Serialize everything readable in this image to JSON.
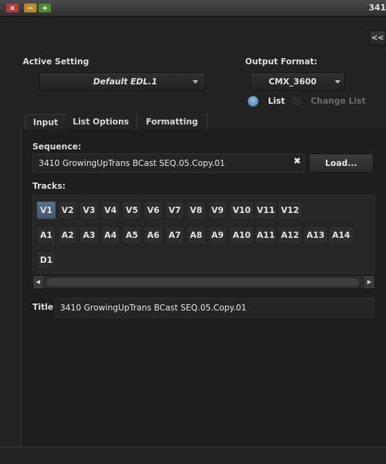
{
  "window": {
    "title_number": "341",
    "collapse_label": "<<"
  },
  "settings": {
    "active_setting_label": "Active Setting",
    "active_setting_value": "Default EDL.1",
    "output_format_label": "Output Format:",
    "output_format_value": "CMX_3600",
    "radio_list": "List",
    "radio_change_list": "Change List",
    "list_selected": true
  },
  "tabs": [
    {
      "label": "Input",
      "active": true
    },
    {
      "label": "List Options",
      "active": false
    },
    {
      "label": "Formatting",
      "active": false
    }
  ],
  "input": {
    "sequence_label": "Sequence:",
    "sequence_value": "3410 GrowingUpTrans BCast SEQ.05.Copy.01",
    "clear_glyph": "✖",
    "load_label": "Load...",
    "tracks_label": "Tracks:",
    "title_label": "Title",
    "title_value": "3410 GrowingUpTrans BCast SEQ.05.Copy.01"
  },
  "tracks": {
    "video": [
      "V1",
      "V2",
      "V3",
      "V4",
      "V5",
      "V6",
      "V7",
      "V8",
      "V9",
      "V10",
      "V11",
      "V12"
    ],
    "audio": [
      "A1",
      "A2",
      "A3",
      "A4",
      "A5",
      "A6",
      "A7",
      "A8",
      "A9",
      "A10",
      "A11",
      "A12",
      "A13",
      "A14"
    ],
    "data": [
      "D1"
    ],
    "selected": [
      "V1"
    ]
  },
  "colors": {
    "selected_track": "#506379",
    "radio_on": "#6f9ccb"
  }
}
